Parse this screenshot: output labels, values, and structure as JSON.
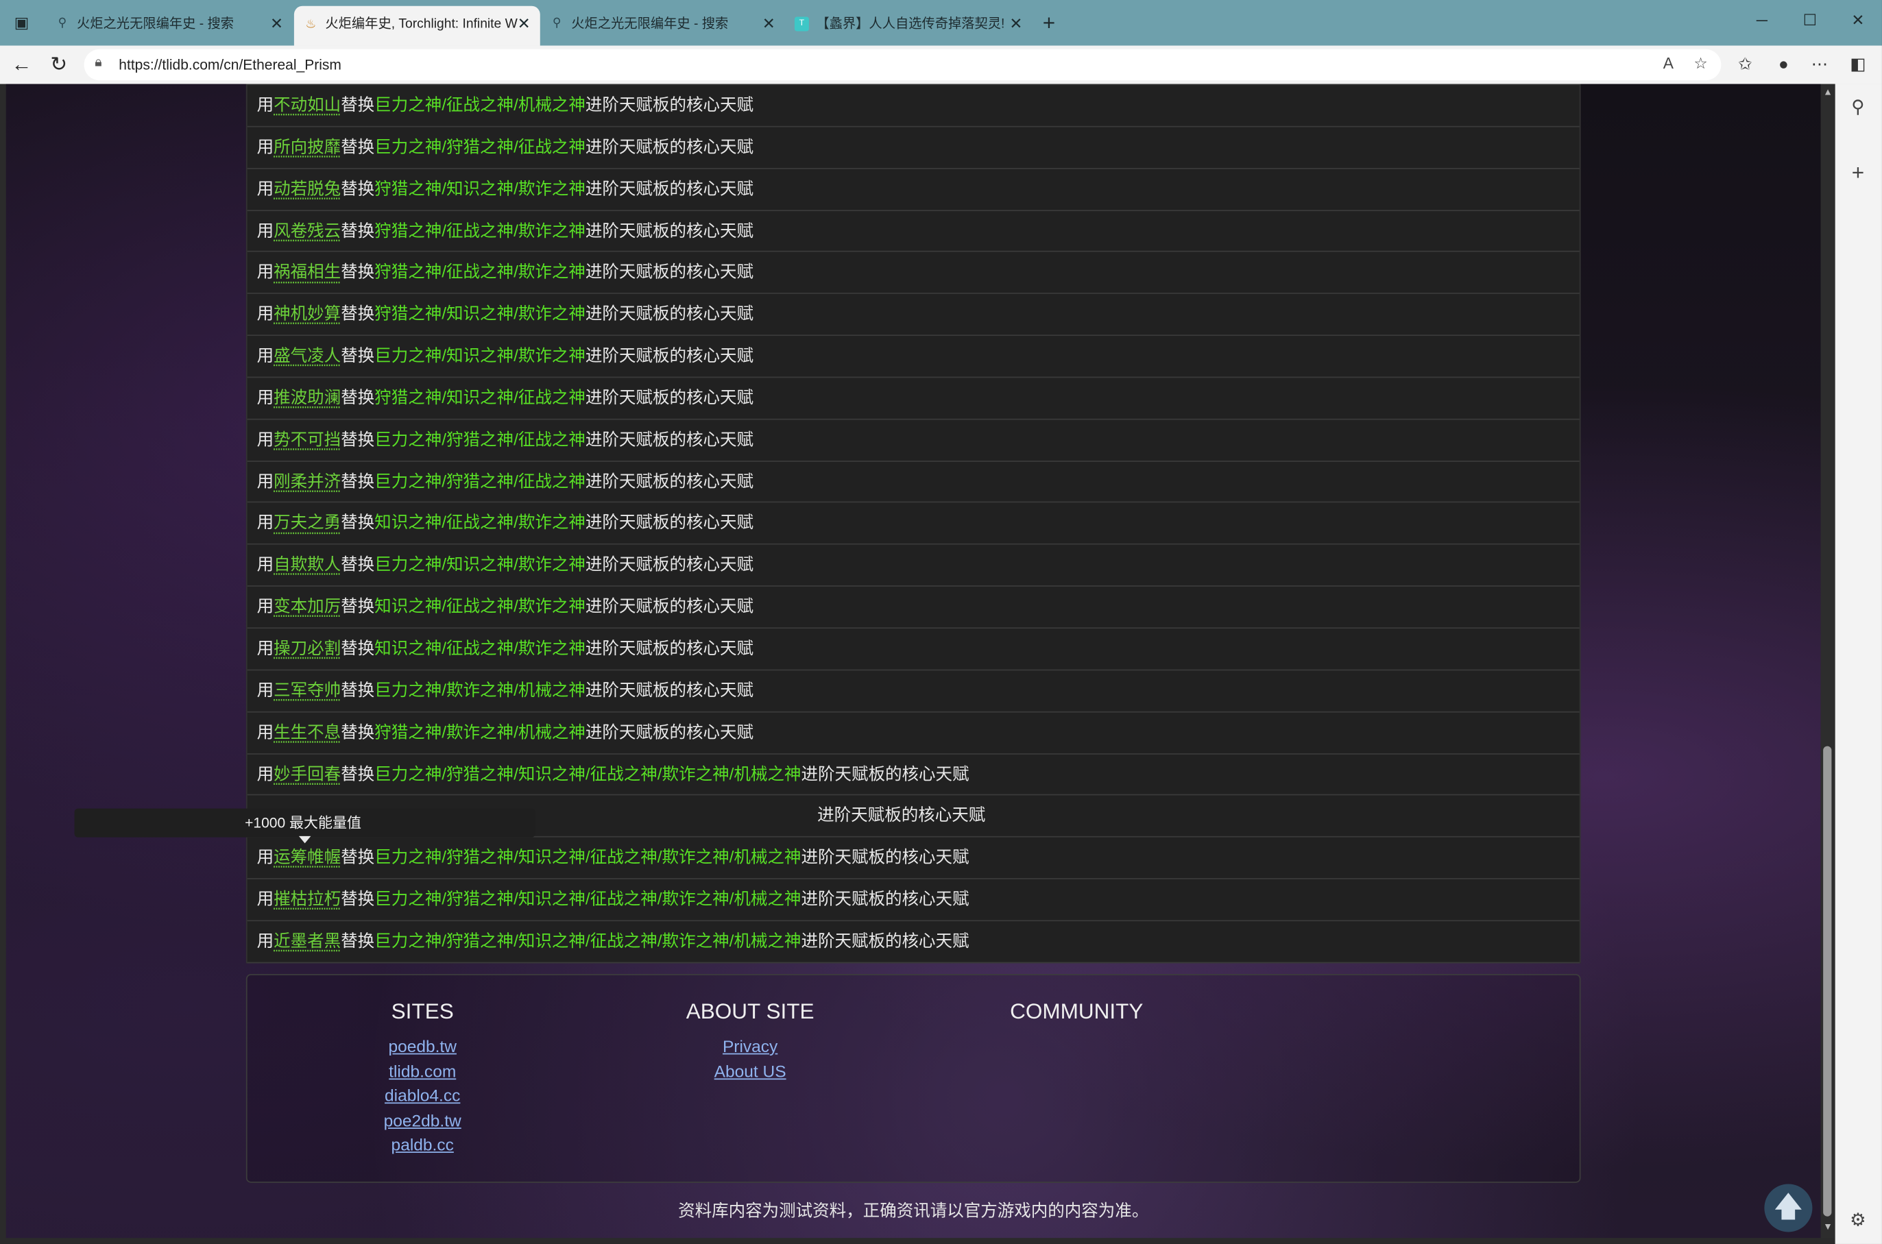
{
  "browser": {
    "tabs": [
      {
        "title": "火炬之光无限编年史 - 搜索",
        "favicon": "search-icon",
        "active": false
      },
      {
        "title": "火炬编年史, Torchlight: Infinite W",
        "favicon": "torch-icon",
        "active": true
      },
      {
        "title": "火炬之光无限编年史 - 搜索",
        "favicon": "search-icon",
        "active": false
      },
      {
        "title": "【蠡界】人人自选传奇掉落契灵!",
        "favicon": "tap-icon",
        "active": false
      }
    ],
    "url": "https://tlidb.com/cn/Ethereal_Prism"
  },
  "talent_rows": [
    {
      "prefix": "用",
      "talent": "不动如山",
      "mid": "替换",
      "gods": "巨力之神/征战之神/机械之神",
      "suffix": "进阶天赋板的核心天赋"
    },
    {
      "prefix": "用",
      "talent": "所向披靡",
      "mid": "替换",
      "gods": "巨力之神/狩猎之神/征战之神",
      "suffix": "进阶天赋板的核心天赋"
    },
    {
      "prefix": "用",
      "talent": "动若脱兔",
      "mid": "替换",
      "gods": "狩猎之神/知识之神/欺诈之神",
      "suffix": "进阶天赋板的核心天赋"
    },
    {
      "prefix": "用",
      "talent": "风卷残云",
      "mid": "替换",
      "gods": "狩猎之神/征战之神/欺诈之神",
      "suffix": "进阶天赋板的核心天赋"
    },
    {
      "prefix": "用",
      "talent": "祸福相生",
      "mid": "替换",
      "gods": "狩猎之神/征战之神/欺诈之神",
      "suffix": "进阶天赋板的核心天赋"
    },
    {
      "prefix": "用",
      "talent": "神机妙算",
      "mid": "替换",
      "gods": "狩猎之神/知识之神/欺诈之神",
      "suffix": "进阶天赋板的核心天赋"
    },
    {
      "prefix": "用",
      "talent": "盛气凌人",
      "mid": "替换",
      "gods": "巨力之神/知识之神/欺诈之神",
      "suffix": "进阶天赋板的核心天赋"
    },
    {
      "prefix": "用",
      "talent": "推波助澜",
      "mid": "替换",
      "gods": "狩猎之神/知识之神/征战之神",
      "suffix": "进阶天赋板的核心天赋"
    },
    {
      "prefix": "用",
      "talent": "势不可挡",
      "mid": "替换",
      "gods": "巨力之神/狩猎之神/征战之神",
      "suffix": "进阶天赋板的核心天赋"
    },
    {
      "prefix": "用",
      "talent": "刚柔并济",
      "mid": "替换",
      "gods": "巨力之神/狩猎之神/征战之神",
      "suffix": "进阶天赋板的核心天赋"
    },
    {
      "prefix": "用",
      "talent": "万夫之勇",
      "mid": "替换",
      "gods": "知识之神/征战之神/欺诈之神",
      "suffix": "进阶天赋板的核心天赋"
    },
    {
      "prefix": "用",
      "talent": "自欺欺人",
      "mid": "替换",
      "gods": "巨力之神/知识之神/欺诈之神",
      "suffix": "进阶天赋板的核心天赋"
    },
    {
      "prefix": "用",
      "talent": "变本加厉",
      "mid": "替换",
      "gods": "知识之神/征战之神/欺诈之神",
      "suffix": "进阶天赋板的核心天赋"
    },
    {
      "prefix": "用",
      "talent": "操刀必割",
      "mid": "替换",
      "gods": "知识之神/征战之神/欺诈之神",
      "suffix": "进阶天赋板的核心天赋"
    },
    {
      "prefix": "用",
      "talent": "三军夺帅",
      "mid": "替换",
      "gods": "巨力之神/欺诈之神/机械之神",
      "suffix": "进阶天赋板的核心天赋"
    },
    {
      "prefix": "用",
      "talent": "生生不息",
      "mid": "替换",
      "gods": "狩猎之神/欺诈之神/机械之神",
      "suffix": "进阶天赋板的核心天赋"
    },
    {
      "prefix": "用",
      "talent": "妙手回春",
      "mid": "替换",
      "gods": "巨力之神/狩猎之神/知识之神/征战之神/欺诈之神/机械之神",
      "suffix": "进阶天赋板的核心天赋"
    },
    {
      "prefix": "",
      "talent": "",
      "mid": "",
      "gods": "",
      "suffix": "进阶天赋板的核心天赋"
    },
    {
      "prefix": "用",
      "talent": "运筹帷幄",
      "mid": "替换",
      "gods": "巨力之神/狩猎之神/知识之神/征战之神/欺诈之神/机械之神",
      "suffix": "进阶天赋板的核心天赋"
    },
    {
      "prefix": "用",
      "talent": "摧枯拉朽",
      "mid": "替换",
      "gods": "巨力之神/狩猎之神/知识之神/征战之神/欺诈之神/机械之神",
      "suffix": "进阶天赋板的核心天赋"
    },
    {
      "prefix": "用",
      "talent": "近墨者黑",
      "mid": "替换",
      "gods": "巨力之神/狩猎之神/知识之神/征战之神/欺诈之神/机械之神",
      "suffix": "进阶天赋板的核心天赋"
    }
  ],
  "tooltip": {
    "text": "+1000 最大能量值"
  },
  "footer": {
    "sites_title": "SITES",
    "sites": [
      "poedb.tw",
      "tlidb.com",
      "diablo4.cc",
      "poe2db.tw",
      "paldb.cc"
    ],
    "about_title": "ABOUT SITE",
    "about_links": [
      "Privacy",
      "About US"
    ],
    "community_title": "COMMUNITY",
    "disclaimer": "资料库内容为测试资料，正确资讯请以官方游戏内的内容为准。"
  },
  "colors": {
    "talent_link": "#6cd13a",
    "gods": "#58e025",
    "tabbar": "#6ea0ac"
  }
}
